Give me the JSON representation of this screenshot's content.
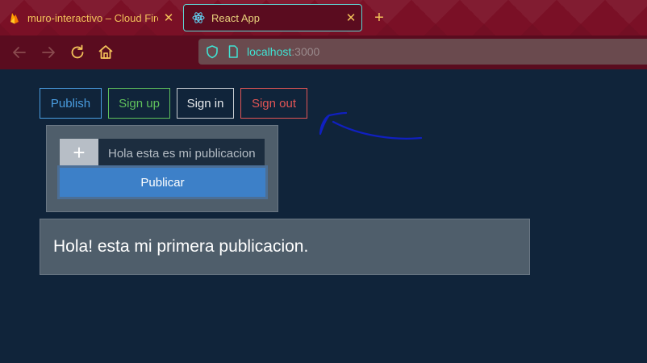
{
  "browser": {
    "tabs": [
      {
        "title": "muro-interactivo – Cloud Firest",
        "icon": "firebase-icon",
        "active": false
      },
      {
        "title": "React App",
        "icon": "react-icon",
        "active": true
      }
    ],
    "close_glyph": "✕",
    "new_tab_glyph": "+",
    "url": {
      "host": "localhost",
      "port": ":3000"
    },
    "colors": {
      "tabbar": "#7a1026",
      "navbar": "#5a0c1f",
      "accent": "#5fd5d2"
    }
  },
  "app": {
    "menu": {
      "publish": "Publish",
      "signup": "Sign up",
      "signin": "Sign in",
      "signout": "Sign out"
    },
    "composer": {
      "plus": "+",
      "input_value": "Hola esta es mi publicacion",
      "submit_label": "Publicar"
    },
    "posts": [
      {
        "text": "Hola! esta mi primera publicacion."
      }
    ],
    "colors": {
      "background": "#10243a",
      "publish": "#4a9de0",
      "signup": "#5fc05c",
      "signout": "#e25555",
      "primary_button": "#3d80c8",
      "panel": "#4f5e6b",
      "annotation": "#1020c0"
    }
  }
}
